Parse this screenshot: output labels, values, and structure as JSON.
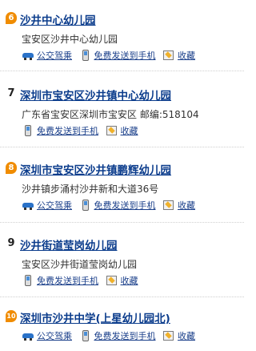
{
  "actions": {
    "transit": "公交驾乘",
    "sms": "免费发送到手机",
    "fav": "收藏"
  },
  "results": [
    {
      "index": "6",
      "style": "badge",
      "title": "沙井中心幼儿园",
      "address": "宝安区沙井中心幼儿园",
      "show_transit": true
    },
    {
      "index": "7",
      "style": "plain",
      "title": "深圳市宝安区沙井镇中心幼儿园",
      "address": "广东省宝安区深圳市宝安区 邮编:518104",
      "show_transit": false
    },
    {
      "index": "8",
      "style": "badge",
      "title": "深圳市宝安区沙井镇鹏辉幼儿园",
      "address": "沙井镇步涌村沙井新和大道36号",
      "show_transit": true
    },
    {
      "index": "9",
      "style": "plain",
      "title": "沙井街道莹岗幼儿园",
      "address": "宝安区沙井街道莹岗幼儿园",
      "show_transit": false
    },
    {
      "index": "10",
      "style": "badge",
      "title": "深圳市沙井中学(上星幼儿园北)",
      "address": "",
      "show_transit": true
    }
  ]
}
